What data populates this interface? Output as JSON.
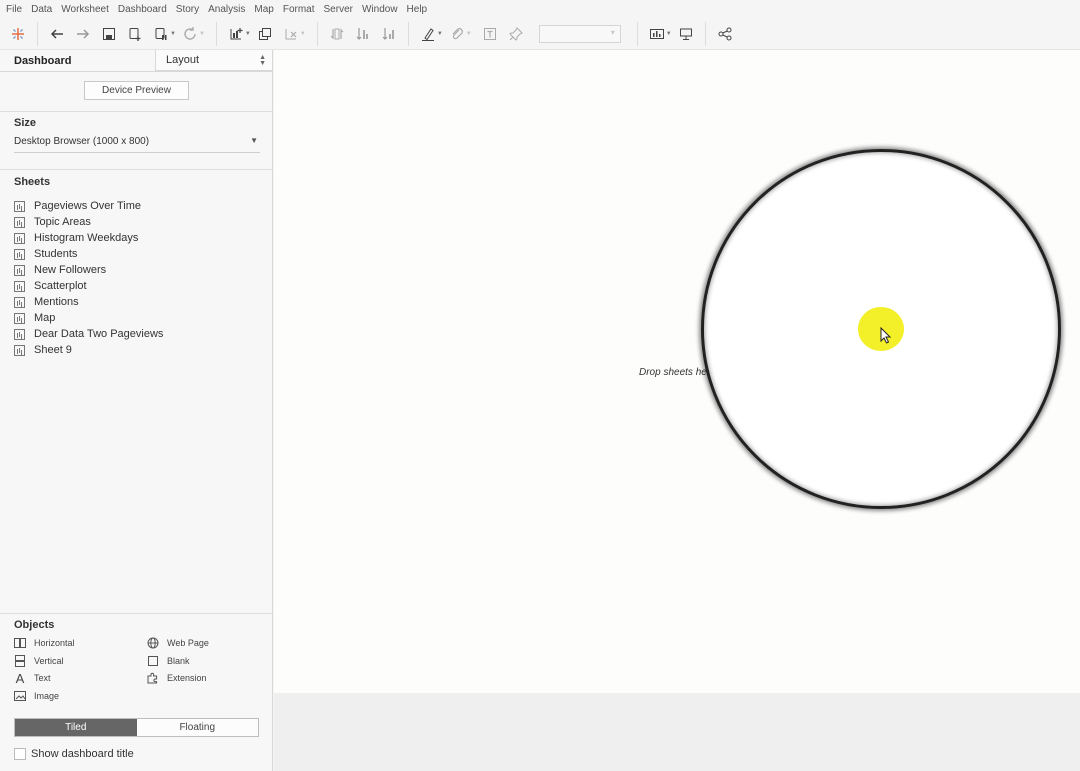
{
  "menu": [
    "File",
    "Data",
    "Worksheet",
    "Dashboard",
    "Story",
    "Analysis",
    "Map",
    "Format",
    "Server",
    "Window",
    "Help"
  ],
  "toolbar_icons": [
    "tableau-logo-icon",
    "undo-icon",
    "redo-icon",
    "save-icon",
    "new-datasource-icon",
    "pause-updates-icon",
    "refresh-icon",
    "new-worksheet-icon",
    "duplicate-icon",
    "clear-sheet-icon",
    "swap-icon",
    "sort-ascending-icon",
    "sort-descending-icon",
    "highlight-icon",
    "attach-icon",
    "text-icon",
    "pin-icon",
    "show-me-icon",
    "presentation-icon",
    "share-icon"
  ],
  "panel": {
    "tab_dashboard": "Dashboard",
    "tab_layout": "Layout",
    "device_preview": "Device Preview",
    "size_title": "Size",
    "size_value": "Desktop Browser (1000 x 800)",
    "sheets_title": "Sheets",
    "sheets": [
      "Pageviews Over Time",
      "Topic Areas",
      "Histogram Weekdays",
      "Students",
      "New Followers",
      "Scatterplot",
      "Mentions",
      "Map",
      "Dear Data Two Pageviews",
      "Sheet 9"
    ],
    "objects_title": "Objects",
    "objects": {
      "horizontal": "Horizontal",
      "vertical": "Vertical",
      "text": "Text",
      "image": "Image",
      "web_page": "Web Page",
      "blank": "Blank",
      "extension": "Extension"
    },
    "tiled": "Tiled",
    "floating": "Floating",
    "show_title": "Show dashboard title"
  },
  "canvas": {
    "drop_hint": "Drop sheets he"
  }
}
